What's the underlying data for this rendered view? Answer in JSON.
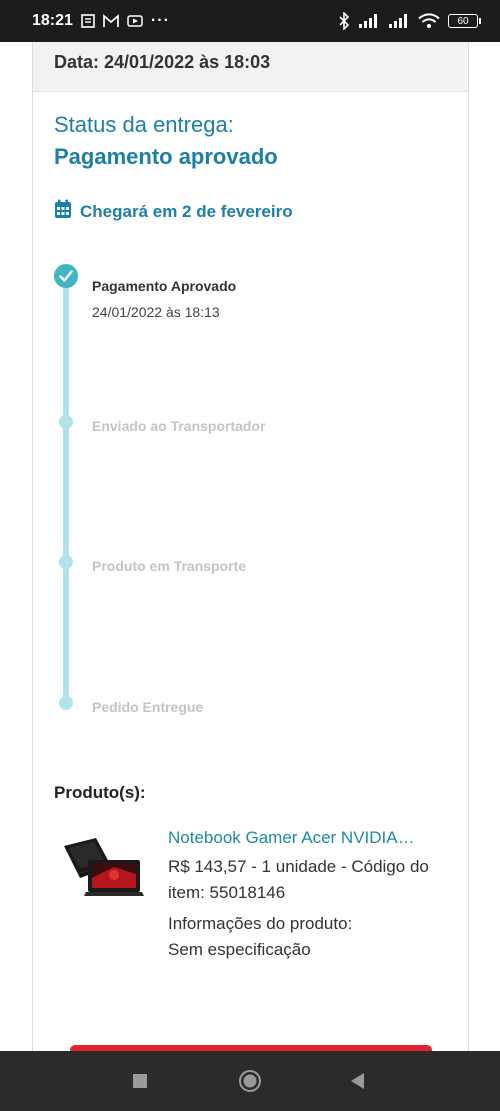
{
  "status_bar": {
    "time": "18:21",
    "more": "···",
    "battery": "60"
  },
  "order": {
    "date_text": "Data: 24/01/2022 às 18:03",
    "status_label": "Status da entrega:",
    "status_value": "Pagamento aprovado",
    "arrival_text": "Chegará em 2 de fevereiro"
  },
  "timeline": {
    "steps": [
      {
        "label": "Pagamento Aprovado",
        "date": "24/01/2022 às 18:13",
        "done": true
      },
      {
        "label": "Enviado ao Transportador",
        "done": false
      },
      {
        "label": "Produto em Transporte",
        "done": false
      },
      {
        "label": "Pedido Entregue",
        "done": false
      }
    ]
  },
  "products": {
    "title": "Produto(s):",
    "items": [
      {
        "name": "Notebook Gamer Acer NVIDIA…",
        "details": "R$ 143,57 - 1 unidade - Código do item: 55018146",
        "info_label": "Informações do produto:",
        "info_value": "Sem especificação"
      }
    ]
  },
  "colors": {
    "accent": "#1d7fa8",
    "timeline": "#3fb6c4",
    "cta": "#e0252f"
  }
}
